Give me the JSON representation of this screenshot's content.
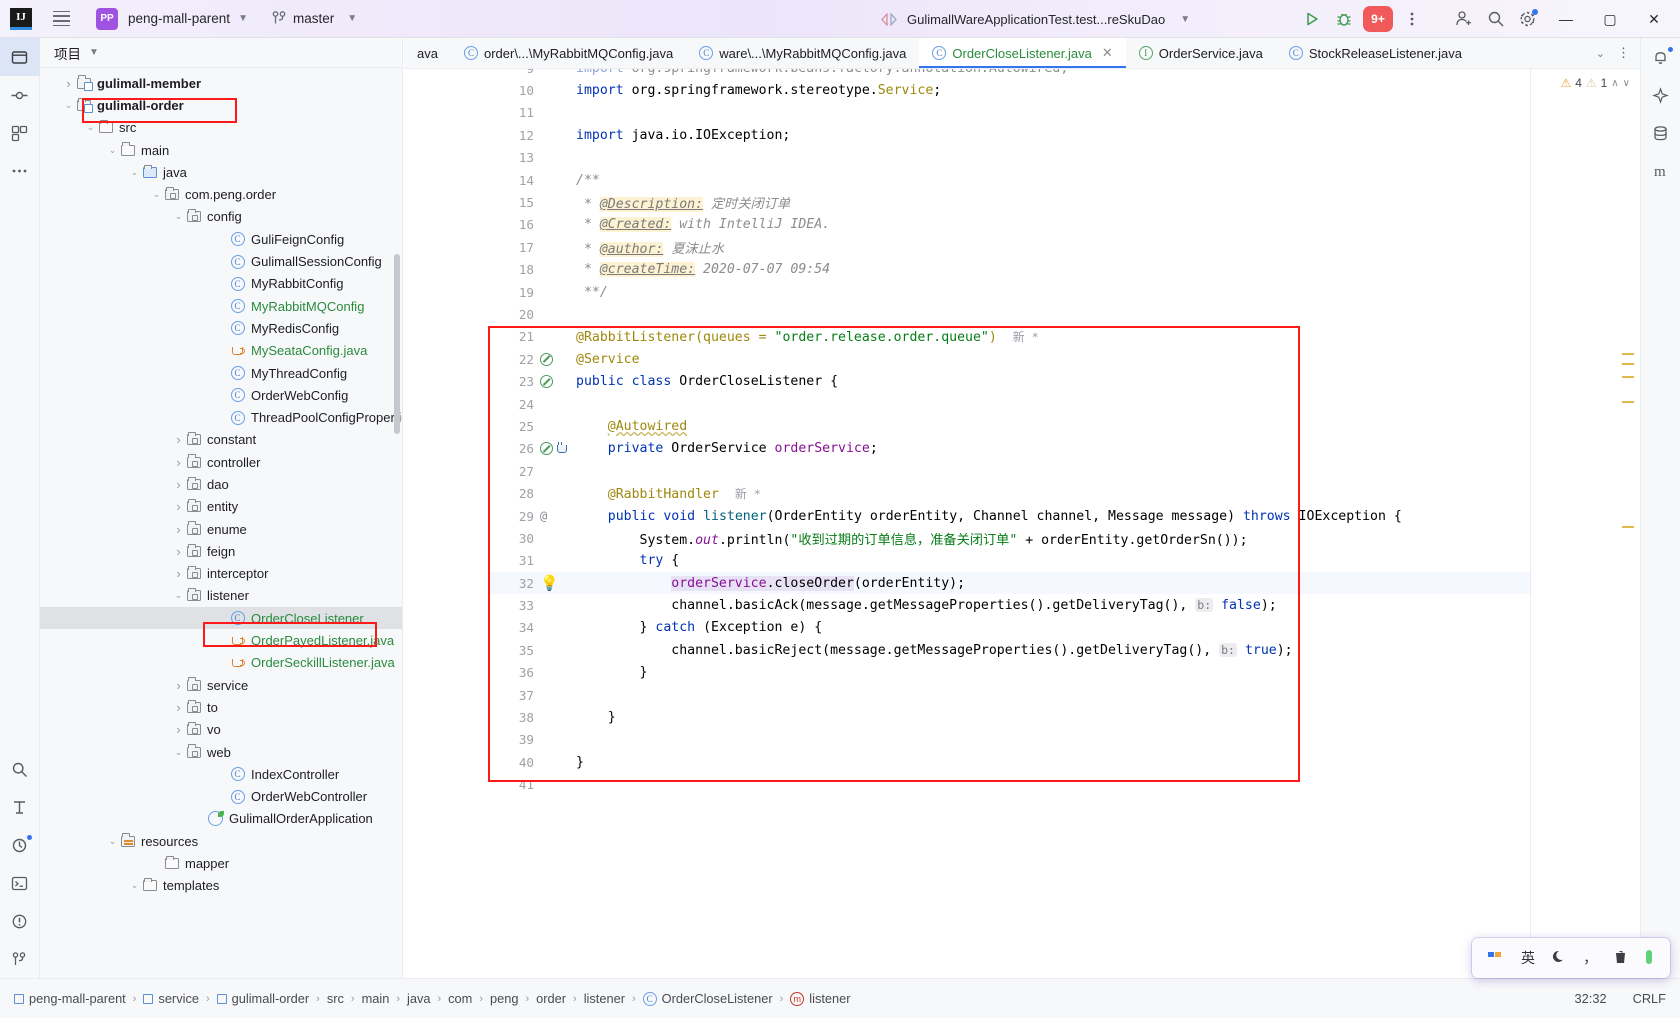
{
  "titlebar": {
    "logo": "IJ",
    "project_badge": "PP",
    "project_name": "peng-mall-parent",
    "branch": "master",
    "run_config": "GulimallWareApplicationTest.test...reSkuDao",
    "run_badge": "9+",
    "icons": {
      "menu": "hamburger-icon",
      "vcs": "branch-icon",
      "run": "run-icon",
      "debug": "debug-icon",
      "more": "more-vertical-icon",
      "share": "add-user-icon",
      "search": "search-icon",
      "settings": "gear-icon",
      "minimize": "minimize-icon",
      "maximize": "maximize-icon",
      "close": "close-icon"
    }
  },
  "project_panel": {
    "title": "项目",
    "tree": [
      {
        "depth": 3,
        "arrow": "right",
        "icon": "module",
        "label": "gulimall-member",
        "bold": true,
        "green": false,
        "selected": false,
        "boxed": false
      },
      {
        "depth": 3,
        "arrow": "down",
        "icon": "module",
        "label": "gulimall-order",
        "bold": true,
        "green": false,
        "selected": false,
        "boxed": true
      },
      {
        "depth": 4,
        "arrow": "down",
        "icon": "folder",
        "label": "src",
        "bold": false,
        "green": false,
        "selected": false,
        "boxed": false
      },
      {
        "depth": 5,
        "arrow": "down",
        "icon": "folder",
        "label": "main",
        "bold": false,
        "green": false,
        "selected": false,
        "boxed": false
      },
      {
        "depth": 6,
        "arrow": "down",
        "icon": "source",
        "label": "java",
        "bold": false,
        "green": false,
        "selected": false,
        "boxed": false
      },
      {
        "depth": 7,
        "arrow": "down",
        "icon": "package",
        "label": "com.peng.order",
        "bold": false,
        "green": false,
        "selected": false,
        "boxed": false
      },
      {
        "depth": 8,
        "arrow": "down",
        "icon": "package",
        "label": "config",
        "bold": false,
        "green": false,
        "selected": false,
        "boxed": false
      },
      {
        "depth": 10,
        "arrow": "none",
        "icon": "class",
        "label": "GuliFeignConfig",
        "bold": false,
        "green": false,
        "selected": false,
        "boxed": false
      },
      {
        "depth": 10,
        "arrow": "none",
        "icon": "class",
        "label": "GulimallSessionConfig",
        "bold": false,
        "green": false,
        "selected": false,
        "boxed": false
      },
      {
        "depth": 10,
        "arrow": "none",
        "icon": "class",
        "label": "MyRabbitConfig",
        "bold": false,
        "green": false,
        "selected": false,
        "boxed": false
      },
      {
        "depth": 10,
        "arrow": "none",
        "icon": "class",
        "label": "MyRabbitMQConfig",
        "bold": false,
        "green": true,
        "selected": false,
        "boxed": false
      },
      {
        "depth": 10,
        "arrow": "none",
        "icon": "class",
        "label": "MyRedisConfig",
        "bold": false,
        "green": false,
        "selected": false,
        "boxed": false
      },
      {
        "depth": 10,
        "arrow": "none",
        "icon": "java",
        "label": "MySeataConfig.java",
        "bold": false,
        "green": true,
        "selected": false,
        "boxed": false
      },
      {
        "depth": 10,
        "arrow": "none",
        "icon": "class",
        "label": "MyThreadConfig",
        "bold": false,
        "green": false,
        "selected": false,
        "boxed": false
      },
      {
        "depth": 10,
        "arrow": "none",
        "icon": "class",
        "label": "OrderWebConfig",
        "bold": false,
        "green": false,
        "selected": false,
        "boxed": false
      },
      {
        "depth": 10,
        "arrow": "none",
        "icon": "class",
        "label": "ThreadPoolConfigProperties",
        "bold": false,
        "green": false,
        "selected": false,
        "boxed": false
      },
      {
        "depth": 8,
        "arrow": "right",
        "icon": "package",
        "label": "constant",
        "bold": false,
        "green": false,
        "selected": false,
        "boxed": false
      },
      {
        "depth": 8,
        "arrow": "right",
        "icon": "package",
        "label": "controller",
        "bold": false,
        "green": false,
        "selected": false,
        "boxed": false
      },
      {
        "depth": 8,
        "arrow": "right",
        "icon": "package",
        "label": "dao",
        "bold": false,
        "green": false,
        "selected": false,
        "boxed": false
      },
      {
        "depth": 8,
        "arrow": "right",
        "icon": "package",
        "label": "entity",
        "bold": false,
        "green": false,
        "selected": false,
        "boxed": false
      },
      {
        "depth": 8,
        "arrow": "right",
        "icon": "package",
        "label": "enume",
        "bold": false,
        "green": false,
        "selected": false,
        "boxed": false
      },
      {
        "depth": 8,
        "arrow": "right",
        "icon": "package",
        "label": "feign",
        "bold": false,
        "green": false,
        "selected": false,
        "boxed": false
      },
      {
        "depth": 8,
        "arrow": "right",
        "icon": "package",
        "label": "interceptor",
        "bold": false,
        "green": false,
        "selected": false,
        "boxed": false
      },
      {
        "depth": 8,
        "arrow": "down",
        "icon": "package",
        "label": "listener",
        "bold": false,
        "green": false,
        "selected": false,
        "boxed": false
      },
      {
        "depth": 10,
        "arrow": "none",
        "icon": "class",
        "label": "OrderCloseListener",
        "bold": false,
        "green": true,
        "selected": true,
        "boxed": true
      },
      {
        "depth": 10,
        "arrow": "none",
        "icon": "java",
        "label": "OrderPayedListener.java",
        "bold": false,
        "green": true,
        "selected": false,
        "boxed": false
      },
      {
        "depth": 10,
        "arrow": "none",
        "icon": "java",
        "label": "OrderSeckillListener.java",
        "bold": false,
        "green": true,
        "selected": false,
        "boxed": false
      },
      {
        "depth": 8,
        "arrow": "right",
        "icon": "package",
        "label": "service",
        "bold": false,
        "green": false,
        "selected": false,
        "boxed": false
      },
      {
        "depth": 8,
        "arrow": "right",
        "icon": "package",
        "label": "to",
        "bold": false,
        "green": false,
        "selected": false,
        "boxed": false
      },
      {
        "depth": 8,
        "arrow": "right",
        "icon": "package",
        "label": "vo",
        "bold": false,
        "green": false,
        "selected": false,
        "boxed": false
      },
      {
        "depth": 8,
        "arrow": "down",
        "icon": "package",
        "label": "web",
        "bold": false,
        "green": false,
        "selected": false,
        "boxed": false
      },
      {
        "depth": 10,
        "arrow": "none",
        "icon": "class",
        "label": "IndexController",
        "bold": false,
        "green": false,
        "selected": false,
        "boxed": false
      },
      {
        "depth": 10,
        "arrow": "none",
        "icon": "class",
        "label": "OrderWebController",
        "bold": false,
        "green": false,
        "selected": false,
        "boxed": false
      },
      {
        "depth": 9,
        "arrow": "none",
        "icon": "spring",
        "label": "GulimallOrderApplication",
        "bold": false,
        "green": false,
        "selected": false,
        "boxed": false
      },
      {
        "depth": 5,
        "arrow": "down",
        "icon": "resources",
        "label": "resources",
        "bold": false,
        "green": false,
        "selected": false,
        "boxed": false
      },
      {
        "depth": 7,
        "arrow": "none",
        "icon": "plainfolder",
        "label": "mapper",
        "bold": false,
        "green": false,
        "selected": false,
        "boxed": false
      },
      {
        "depth": 6,
        "arrow": "down",
        "icon": "plainfolder",
        "label": "templates",
        "bold": false,
        "green": false,
        "selected": false,
        "boxed": false
      }
    ]
  },
  "tabs": [
    {
      "label": "ava",
      "icon": "class",
      "active": false,
      "partial": true,
      "color": "normal"
    },
    {
      "label": "order\\...\\MyRabbitMQConfig.java",
      "icon": "class",
      "active": false,
      "partial": false,
      "color": "normal"
    },
    {
      "label": "ware\\...\\MyRabbitMQConfig.java",
      "icon": "class",
      "active": false,
      "partial": false,
      "color": "normal"
    },
    {
      "label": "OrderCloseListener.java",
      "icon": "class",
      "active": true,
      "partial": false,
      "color": "green"
    },
    {
      "label": "OrderService.java",
      "icon": "interface",
      "active": false,
      "partial": false,
      "color": "normal"
    },
    {
      "label": "StockReleaseListener.java",
      "icon": "class",
      "active": false,
      "partial": false,
      "color": "normal"
    }
  ],
  "editor": {
    "inspections": {
      "warnings": "4",
      "weak_warnings": "1"
    },
    "lines": [
      {
        "n": "9",
        "kind": "cut"
      },
      {
        "n": "10",
        "kind": "import2"
      },
      {
        "n": "11",
        "kind": "blank"
      },
      {
        "n": "12",
        "kind": "import3"
      },
      {
        "n": "13",
        "kind": "blank"
      },
      {
        "n": "14",
        "kind": "docstart"
      },
      {
        "n": "15",
        "kind": "doc_desc"
      },
      {
        "n": "16",
        "kind": "doc_created"
      },
      {
        "n": "17",
        "kind": "doc_author"
      },
      {
        "n": "18",
        "kind": "doc_time"
      },
      {
        "n": "19",
        "kind": "docend"
      },
      {
        "n": "20",
        "kind": "blank"
      },
      {
        "n": "21",
        "kind": "rabbitlistener"
      },
      {
        "n": "22",
        "kind": "service"
      },
      {
        "n": "23",
        "kind": "classdecl"
      },
      {
        "n": "24",
        "kind": "blank"
      },
      {
        "n": "25",
        "kind": "autowired"
      },
      {
        "n": "26",
        "kind": "fielddecl"
      },
      {
        "n": "27",
        "kind": "blank"
      },
      {
        "n": "28",
        "kind": "rabbithandler"
      },
      {
        "n": "29",
        "kind": "methoddecl"
      },
      {
        "n": "30",
        "kind": "println"
      },
      {
        "n": "31",
        "kind": "try"
      },
      {
        "n": "32",
        "kind": "closeorder"
      },
      {
        "n": "33",
        "kind": "basicack"
      },
      {
        "n": "34",
        "kind": "catch"
      },
      {
        "n": "35",
        "kind": "basicreject"
      },
      {
        "n": "36",
        "kind": "closebrace1"
      },
      {
        "n": "37",
        "kind": "blank"
      },
      {
        "n": "38",
        "kind": "closebrace2"
      },
      {
        "n": "39",
        "kind": "blank"
      },
      {
        "n": "40",
        "kind": "closebrace3"
      },
      {
        "n": "41",
        "kind": "blank"
      }
    ],
    "text": {
      "l9": "import org.springframework.beans.factory.annotation.Autowired;",
      "l10_kw": "import",
      "l10_pkg": " org.springframework.stereotype.",
      "l10_cls": "Service",
      "l10_end": ";",
      "l12_kw": "import",
      "l12_rest": " java.io.IOException;",
      "l14": "/**",
      "l15_star": " * ",
      "l15_tag": "@Description:",
      "l15_val": " 定时关闭订单",
      "l16_tag": "@Created:",
      "l16_val": " with IntelliJ IDEA.",
      "l17_tag": "@author:",
      "l17_val": " 夏沫止水",
      "l18_tag": "@createTime:",
      "l18_val": " 2020-07-07 09:54",
      "l19": " **/",
      "l21_anno": "@RabbitListener(queues = ",
      "l21_str": "\"order.release.order.queue\"",
      "l21_close": ")",
      "l21_inlay": "新 *",
      "l22": "@Service",
      "l23_kw1": "public",
      "l23_kw2": "class",
      "l23_name": "OrderCloseListener",
      "l23_brace": "{",
      "l25": "@Autowired",
      "l26_kw": "private",
      "l26_type": "OrderService",
      "l26_name": "orderService",
      "l26_end": ";",
      "l28_anno": "@RabbitHandler",
      "l28_inlay": "新 *",
      "l29_kw1": "public",
      "l29_kw2": "void",
      "l29_name": "listener",
      "l29_params": "(OrderEntity orderEntity, Channel channel, Message message)",
      "l29_throws": "throws",
      "l29_exc": " IOException {",
      "l30_pre": "System.",
      "l30_out": "out",
      "l30_mid": ".println(",
      "l30_str": "\"收到过期的订单信息，准备关闭订单\"",
      "l30_post": " + orderEntity.getOrderSn());",
      "l31": "try {",
      "l32_obj": "orderService",
      "l32_rest": ".closeOrder(orderEntity);",
      "l33_pre": "channel.basicAck(message.getMessageProperties().getDeliveryTag(), ",
      "l33_hint": "b:",
      "l33_val": "false",
      "l33_end": ");",
      "l34_brace": "} ",
      "l34_kw": "catch",
      "l34_rest": " (Exception e) {",
      "l35_pre": "channel.basicReject(message.getMessageProperties().getDeliveryTag(), ",
      "l35_hint": "b:",
      "l35_val": "true",
      "l35_end": ");",
      "l36": "}",
      "l38": "}",
      "l40": "}"
    }
  },
  "statusbar": {
    "breadcrumbs": [
      {
        "label": "peng-mall-parent",
        "icon": "module"
      },
      {
        "label": "service",
        "icon": "module"
      },
      {
        "label": "gulimall-order",
        "icon": "module"
      },
      {
        "label": "src",
        "icon": "none"
      },
      {
        "label": "main",
        "icon": "none"
      },
      {
        "label": "java",
        "icon": "none"
      },
      {
        "label": "com",
        "icon": "none"
      },
      {
        "label": "peng",
        "icon": "none"
      },
      {
        "label": "order",
        "icon": "none"
      },
      {
        "label": "listener",
        "icon": "none"
      },
      {
        "label": "OrderCloseListener",
        "icon": "class"
      },
      {
        "label": "listener",
        "icon": "method"
      }
    ],
    "caret": "32:32",
    "line_ending": "CRLF"
  },
  "ime": {
    "lang": "英",
    "items": [
      "ime-squares-icon",
      "英",
      "moon-icon",
      "，",
      "trash-icon",
      "green-icon"
    ]
  }
}
